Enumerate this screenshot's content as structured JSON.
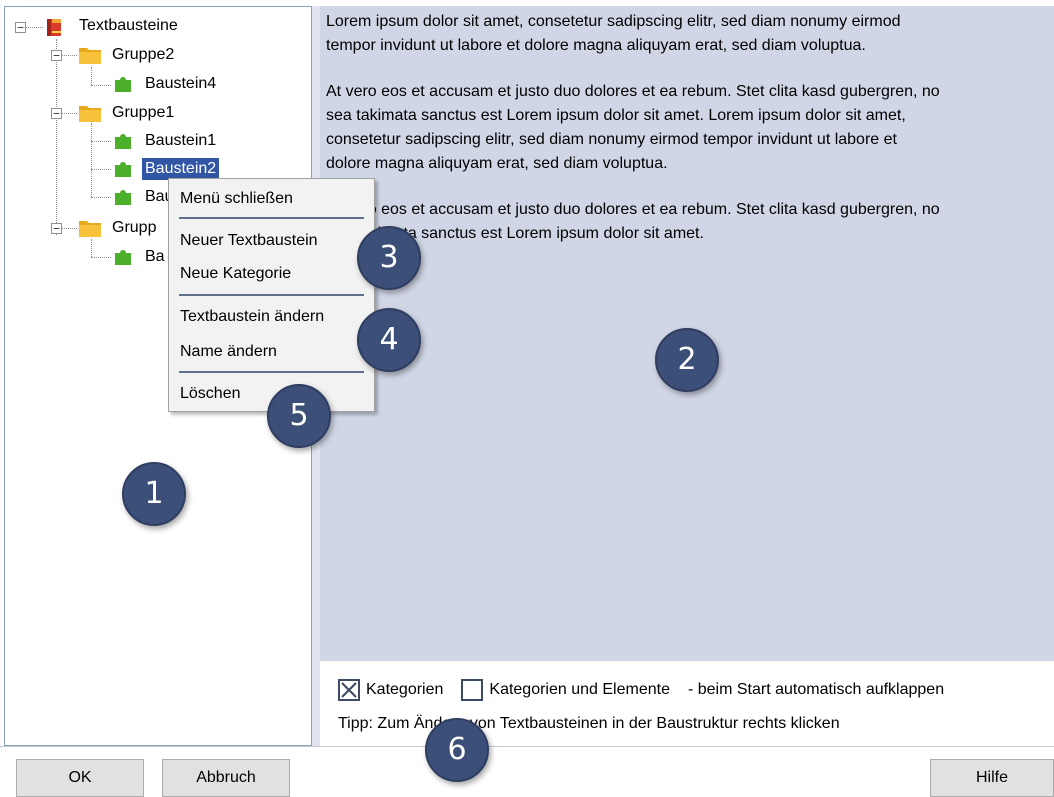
{
  "tree": {
    "root": "Textbausteine",
    "groups": [
      {
        "label": "Gruppe2",
        "items": [
          "Baustein4"
        ]
      },
      {
        "label": "Gruppe1",
        "items": [
          "Baustein1",
          "Baustein2",
          "Bau"
        ]
      },
      {
        "label": "Grupp",
        "items": [
          "Ba"
        ]
      }
    ]
  },
  "preview": {
    "paragraphs": [
      "Lorem ipsum dolor sit amet, consetetur sadipscing elitr, sed diam nonumy eirmod\ntempor invidunt ut labore et dolore magna aliquyam erat, sed diam voluptua.",
      "At vero eos et accusam et justo duo dolores et ea rebum. Stet clita kasd gubergren, no\nsea takimata sanctus est Lorem ipsum dolor sit amet. Lorem ipsum dolor sit amet,\nconsetetur sadipscing elitr, sed diam nonumy eirmod tempor invidunt ut labore et\ndolore magna aliquyam erat, sed diam voluptua.",
      "At vero eos et accusam et justo duo dolores et ea rebum. Stet clita kasd gubergren, no\nsea takimata sanctus est Lorem ipsum dolor sit amet."
    ]
  },
  "options": {
    "checkbox1": {
      "label": "Kategorien",
      "checked": true
    },
    "checkbox2": {
      "label": "Kategorien und Elemente",
      "checked": false
    },
    "suffix": "- beim Start automatisch aufklappen",
    "tip": "Tipp: Zum Ändern von Textbausteinen in der Baustruktur rechts klicken"
  },
  "buttons": {
    "ok": "OK",
    "cancel": "Abbruch",
    "help": "Hilfe"
  },
  "context_menu": {
    "items": [
      "Menü schließen",
      "Neuer Textbaustein",
      "Neue Kategorie",
      "Textbaustein ändern",
      "Name ändern",
      "Löschen"
    ]
  },
  "callouts": [
    "1",
    "2",
    "3",
    "4",
    "5",
    "6"
  ],
  "colors": {
    "selection": "#3256a6",
    "preview_bg": "#d1d6e6",
    "callout": "#3b4f78",
    "folder": "#f7c23a",
    "puzzle": "#4caf2a",
    "book": "#d9392b"
  },
  "icons": {
    "root": "book-icon",
    "group": "folder-icon",
    "item": "puzzle-piece-icon",
    "expander": "collapse-minus-icon"
  }
}
